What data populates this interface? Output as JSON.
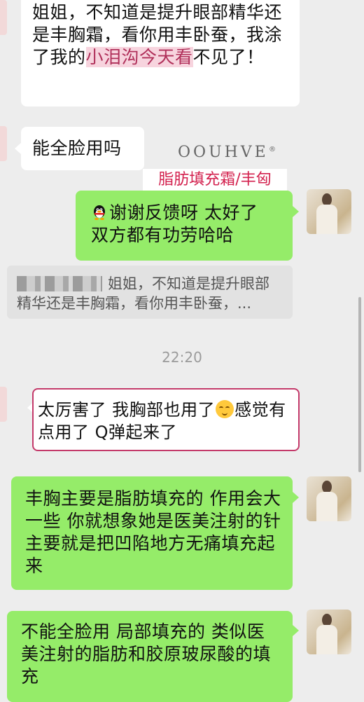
{
  "messages": [
    {
      "id": "m1",
      "text_before": "姐姐，不知道是提升眼部精华还是丰胸霜，看你用丰卧蚕，我涂了我的",
      "highlight": "小泪沟今天看",
      "text_after": "不见了！"
    },
    {
      "id": "m2",
      "text": "能全脸用吗"
    },
    {
      "id": "m3",
      "text": "谢谢反馈呀 太好了 双方都有功劳哈哈"
    },
    {
      "id": "m4",
      "text": "太厉害了 我胸部也用了",
      "text_after": "感觉有点用了 Q弹起来了"
    },
    {
      "id": "m5",
      "text": "丰胸主要是脂肪填充的 作用会大一些 你就想象她是医美注射的针 主要就是把凹陷地方无痛填充起来"
    },
    {
      "id": "m6",
      "text": "不能全脸用 局部填充的 类似医美注射的脂肪和胶原玻尿酸的填充"
    }
  ],
  "quote": {
    "text": "姐姐，不知道是提升眼部精华还是丰胸霜，看你用丰卧蚕，..."
  },
  "timestamp": "22:20",
  "watermark": {
    "brand": "OOUHVE",
    "reg": "®",
    "tag": "脂肪填充霜/丰匈"
  },
  "colors": {
    "incoming": "#ffffff",
    "outgoing": "#95ec69",
    "highlight": "#f7d4de",
    "brand_red": "#d3214e"
  },
  "icons": {
    "qq": "qq-penguin-icon",
    "emoji": "shy-smile-emoji-icon"
  }
}
